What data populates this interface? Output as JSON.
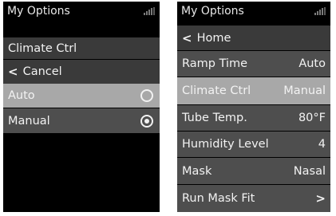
{
  "left_screen": {
    "title": "My Options",
    "section_title": "Climate Ctrl",
    "cancel_label": "Cancel",
    "options": [
      {
        "label": "Auto",
        "selected": false
      },
      {
        "label": "Manual",
        "selected": true
      }
    ]
  },
  "right_screen": {
    "title": "My Options",
    "home_label": "Home",
    "items": [
      {
        "label": "Ramp Time",
        "value": "Auto"
      },
      {
        "label": "Climate Ctrl",
        "value": "Manual"
      },
      {
        "label": "Tube Temp.",
        "value": "80°F"
      },
      {
        "label": "Humidity Level",
        "value": "4"
      },
      {
        "label": "Mask",
        "value": "Nasal"
      },
      {
        "label": "Run Mask Fit",
        "value": ">"
      }
    ],
    "highlighted_item": "Climate Ctrl"
  },
  "icons": {
    "signal": "signal-strength-icon",
    "back": "chevron-left-icon",
    "forward": "chevron-right-icon",
    "radio_empty": "radio-unselected-icon",
    "radio_filled": "radio-selected-icon"
  },
  "colors": {
    "background": "#000000",
    "row_dark": "#3a3a3a",
    "row_mid": "#4e4e4e",
    "row_highlight": "#a8a8a8",
    "text": "#f2f2f2"
  }
}
